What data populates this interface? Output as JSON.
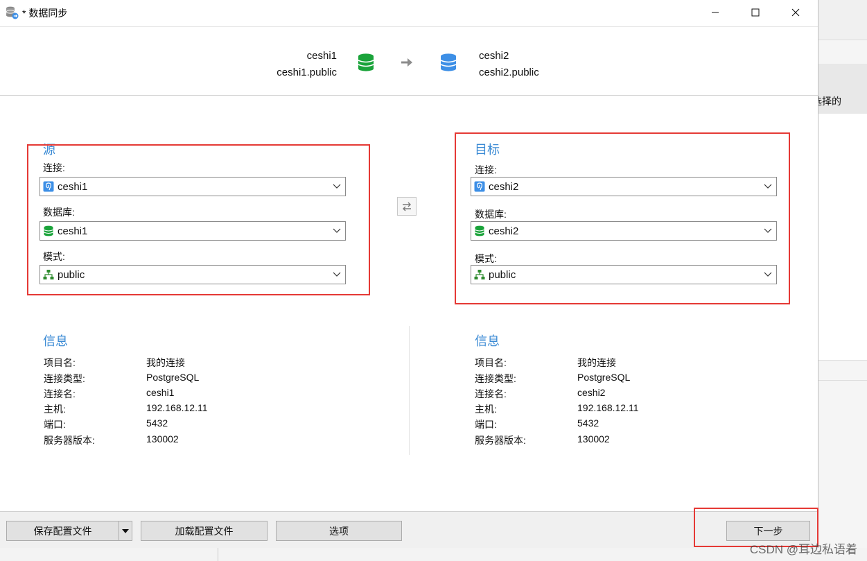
{
  "window": {
    "title": "* 数据同步",
    "icon": "db-sync-icon"
  },
  "header": {
    "source": {
      "connection": "ceshi1",
      "schema_path": "ceshi1.public",
      "icon_color": "#1aa33a"
    },
    "target": {
      "connection": "ceshi2",
      "schema_path": "ceshi2.public",
      "icon_color": "#3d8fe6"
    },
    "arrow_icon": "arrow-right-icon"
  },
  "source_panel": {
    "title": "源",
    "connection_label": "连接:",
    "connection_value": "ceshi1",
    "database_label": "数据库:",
    "database_value": "ceshi1",
    "schema_label": "模式:",
    "schema_value": "public"
  },
  "target_panel": {
    "title": "目标",
    "connection_label": "连接:",
    "connection_value": "ceshi2",
    "database_label": "数据库:",
    "database_value": "ceshi2",
    "schema_label": "模式:",
    "schema_value": "public"
  },
  "source_info": {
    "title": "信息",
    "rows": [
      {
        "key": "项目名:",
        "value": "我的连接"
      },
      {
        "key": "连接类型:",
        "value": "PostgreSQL"
      },
      {
        "key": "连接名:",
        "value": "ceshi1"
      },
      {
        "key": "主机:",
        "value": "192.168.12.11"
      },
      {
        "key": "端口:",
        "value": "5432"
      },
      {
        "key": "服务器版本:",
        "value": "130002"
      }
    ]
  },
  "target_info": {
    "title": "信息",
    "rows": [
      {
        "key": "项目名:",
        "value": "我的连接"
      },
      {
        "key": "连接类型:",
        "value": "PostgreSQL"
      },
      {
        "key": "连接名:",
        "value": "ceshi2"
      },
      {
        "key": "主机:",
        "value": "192.168.12.11"
      },
      {
        "key": "端口:",
        "value": "5432"
      },
      {
        "key": "服务器版本:",
        "value": "130002"
      }
    ]
  },
  "footer": {
    "save_label": "保存配置文件",
    "load_label": "加载配置文件",
    "options_label": "选项",
    "next_label": "下一步"
  },
  "background": {
    "partial_text": "选择的"
  },
  "watermark": "CSDN @耳边私语着",
  "colors": {
    "accent": "#3a8ad4",
    "highlight_border": "#e53935",
    "database_green": "#1aa33a",
    "database_blue": "#3d8fe6",
    "schema_green": "#2e8b2e"
  }
}
